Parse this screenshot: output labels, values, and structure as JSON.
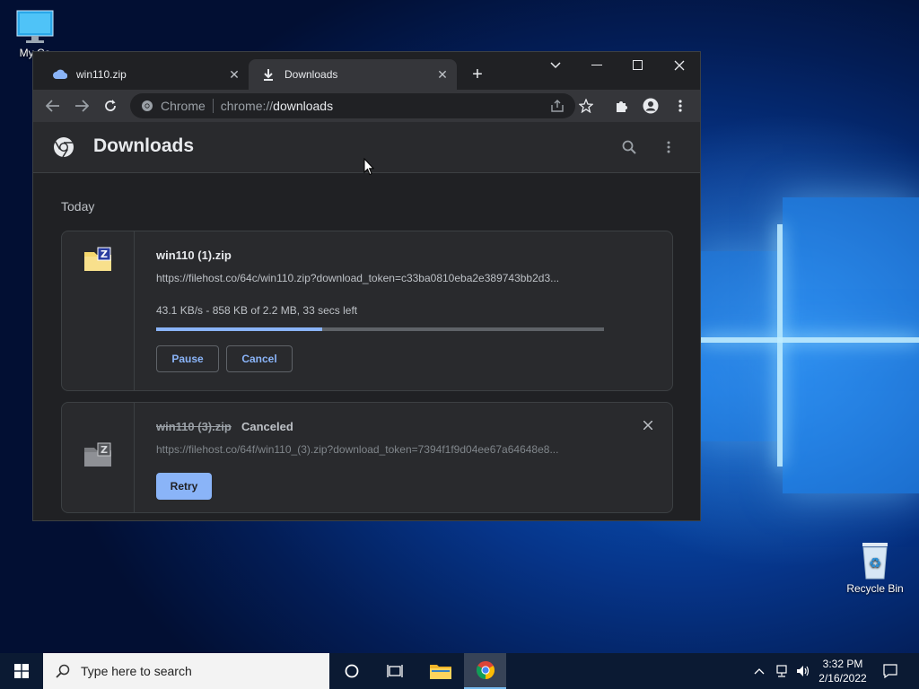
{
  "desktop": {
    "icons": [
      {
        "label": "My Co"
      },
      {
        "label": "Recycle Bin"
      }
    ]
  },
  "browser": {
    "tabs": [
      {
        "title": "win110.zip",
        "icon": "cloud-icon",
        "active": false
      },
      {
        "title": "Downloads",
        "icon": "download-icon",
        "active": true
      }
    ],
    "omnibox": {
      "site": "Chrome",
      "scheme": "chrome://",
      "path": "downloads"
    },
    "page": {
      "title": "Downloads",
      "section": "Today",
      "items": [
        {
          "filename": "win110 (1).zip",
          "url": "https://filehost.co/64c/win110.zip?download_token=c33ba0810eba2e389743bb2d3...",
          "status": "43.1 KB/s - 858 KB of 2.2 MB, 33 secs left",
          "progress": 0.37,
          "pause_label": "Pause",
          "cancel_label": "Cancel"
        },
        {
          "filename": "win110 (3).zip",
          "state": "Canceled",
          "url": "https://filehost.co/64f/win110_(3).zip?download_token=7394f1f9d04ee67a64648e8...",
          "retry_label": "Retry"
        }
      ]
    }
  },
  "taskbar": {
    "search_placeholder": "Type here to search",
    "time": "3:32 PM",
    "date": "2/16/2022"
  },
  "colors": {
    "accent": "#8ab4f8",
    "chrome_bg": "#202124",
    "taskbar_bg": "#0b1a33"
  }
}
